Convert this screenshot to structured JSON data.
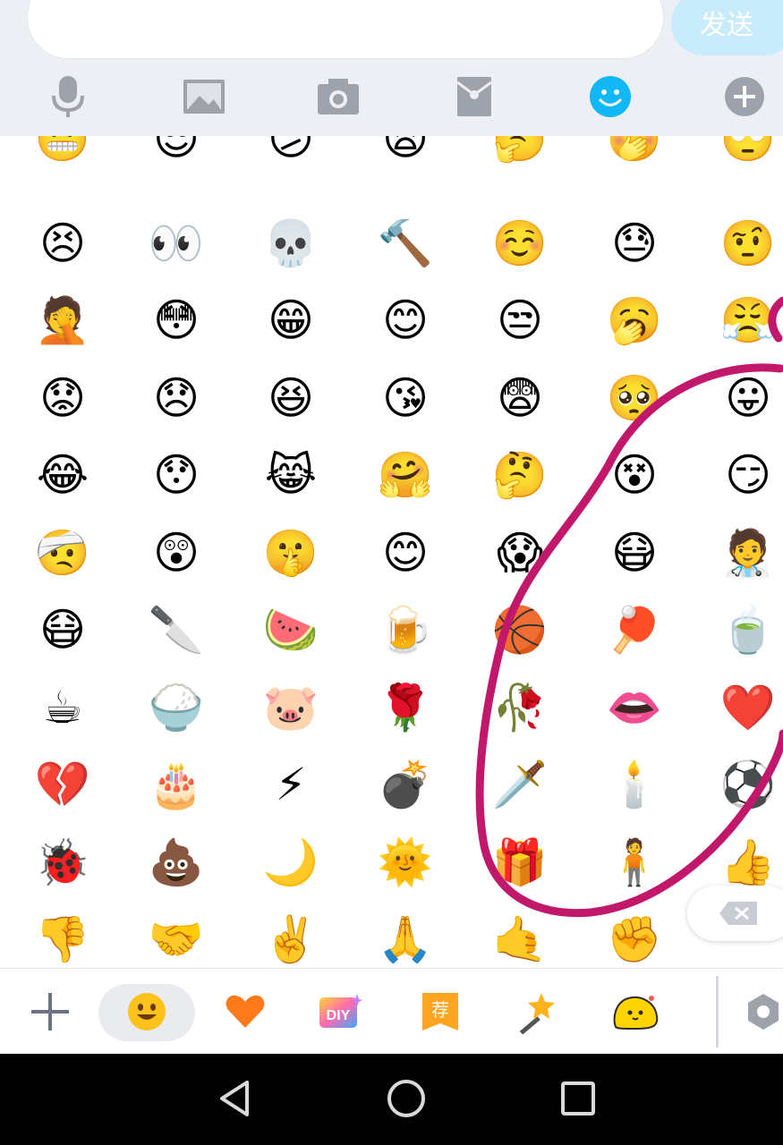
{
  "composer": {
    "input_value": "",
    "send_label": "发送"
  },
  "toolbar": {
    "icons": [
      "microphone-icon",
      "image-icon",
      "camera-icon",
      "red-envelope-icon",
      "emoji-icon",
      "plus-circle-icon"
    ],
    "active": "emoji-icon",
    "active_color": "#12b7f5"
  },
  "emoji_grid": {
    "rows": [
      [
        "😬",
        "😎",
        "😕",
        "😫",
        "🤔",
        "🤭",
        "🙄"
      ],
      [
        "😣",
        "👀",
        "💀",
        "🔨",
        "☺️",
        "😓",
        "🤨"
      ],
      [
        "🤦",
        "😳",
        "😁",
        "😊",
        "😒",
        "🥱",
        "😤"
      ],
      [
        "😟",
        "😞",
        "😆",
        "😘",
        "😨",
        "🥺",
        "😛"
      ],
      [
        "😂",
        "😯",
        "😹",
        "🤗",
        "🤔",
        "😵",
        "😏"
      ],
      [
        "🤕",
        "😲",
        "🤫",
        "😊",
        "😱",
        "😷",
        "🧑‍⚕️"
      ],
      [
        "😷",
        "🔪",
        "🍉",
        "🍺",
        "🏀",
        "🏓",
        "🍵"
      ],
      [
        "☕",
        "🍚",
        "🐷",
        "🌹",
        "🥀",
        "👄",
        "❤️"
      ],
      [
        "💔",
        "🎂",
        "⚡",
        "💣",
        "🗡️",
        "🕯️",
        "⚽"
      ],
      [
        "🐞",
        "💩",
        "🌙",
        "🌞",
        "🎁",
        "🧍",
        "👍"
      ],
      [
        "👎",
        "🤝",
        "✌️",
        "🙏",
        "🤙",
        "✊",
        ""
      ]
    ]
  },
  "tabbar": {
    "tabs": [
      "add-icon",
      "smile-emoji-tab",
      "heart-tab",
      "diy-tab",
      "recommend-tab",
      "magic-wand-tab",
      "blob-character-tab",
      "settings-icon"
    ],
    "selected": "smile-emoji-tab",
    "diy_label": "DIY",
    "recommend_label": "荐"
  },
  "annotation": {
    "color": "#c2186b"
  }
}
